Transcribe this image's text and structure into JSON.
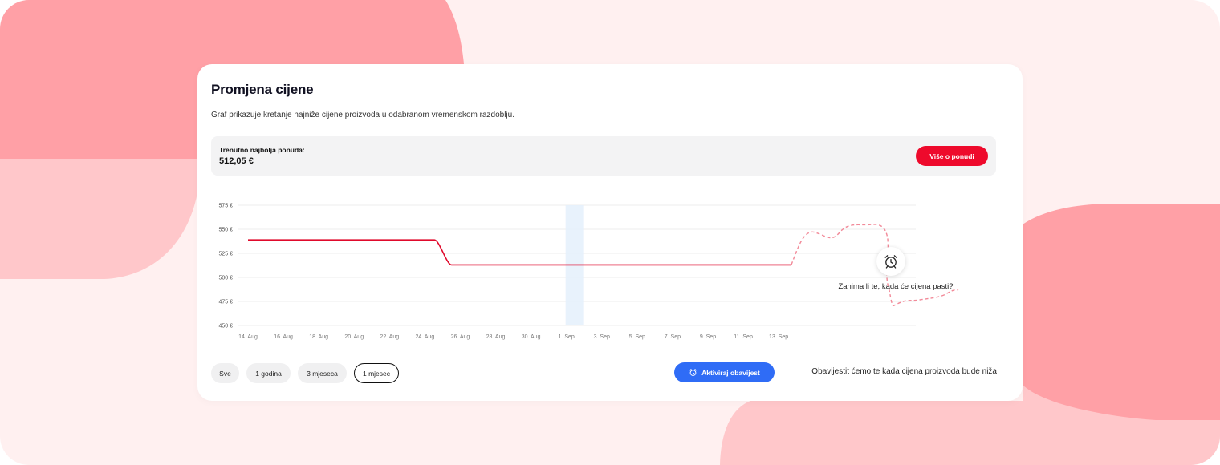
{
  "colors": {
    "accent": "#ee0a2c",
    "alert_blue": "#2f6cf6",
    "background_pink": "#fff0f0",
    "blob_dark": "#ffa0a6",
    "blob_light": "#ffc7ca"
  },
  "card": {
    "title": "Promjena cijene",
    "subtitle": "Graf prikazuje kretanje najniže cijene proizvoda u odabranom vremenskom razdoblju."
  },
  "offer": {
    "label": "Trenutno najbolja ponuda:",
    "price": "512,05 €",
    "button_label": "Više o ponudi"
  },
  "chart_data": {
    "type": "line",
    "y_ticks": [
      "575 €",
      "550 €",
      "525 €",
      "500 €",
      "475 €",
      "450 €"
    ],
    "ylim": [
      450,
      575
    ],
    "x_ticks": [
      "14. Aug",
      "16. Aug",
      "18. Aug",
      "20. Aug",
      "22. Aug",
      "24. Aug",
      "26. Aug",
      "28. Aug",
      "30. Aug",
      "1. Sep",
      "3. Sep",
      "5. Sep",
      "7. Sep",
      "9. Sep",
      "11. Sep",
      "13. Sep"
    ],
    "series": [
      {
        "values": [
          539,
          539,
          539,
          539,
          539,
          539,
          539,
          539,
          539,
          539,
          539,
          539,
          513,
          513,
          513,
          513,
          513,
          513,
          513,
          513,
          513,
          513,
          513,
          513,
          513,
          513,
          513,
          513,
          513,
          513,
          513,
          513,
          513
        ]
      }
    ],
    "highlight_date": "1. Sep",
    "grid": true,
    "line_color": "#e00a2c"
  },
  "prediction": {
    "icon": "alarm-clock-icon",
    "prompt": "Zanima li te, kada će cijena pasti?"
  },
  "ranges": {
    "all": "Sve",
    "year": "1 godina",
    "three_months": "3 mjeseca",
    "month": "1 mjesec",
    "selected": "1 mjesec"
  },
  "alert": {
    "button_label": "Aktiviraj obavijest",
    "icon": "alarm-clock-icon",
    "note": "Obavijestit ćemo te kada cijena proizvoda bude niža"
  }
}
